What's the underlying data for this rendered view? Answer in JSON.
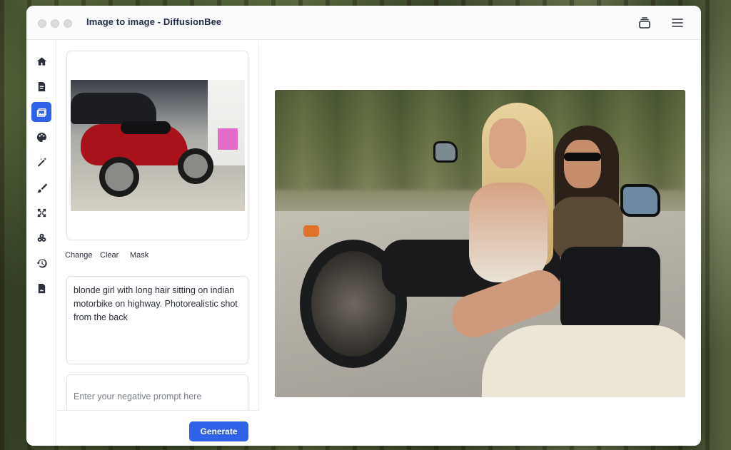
{
  "window": {
    "title": "Image to image - DiffusionBee"
  },
  "titlebar": {
    "icons": [
      "layers-icon",
      "hamburger-menu-icon"
    ]
  },
  "sidebar": {
    "items": [
      {
        "icon": "home-icon",
        "active": false
      },
      {
        "icon": "text-to-image-icon",
        "active": false
      },
      {
        "icon": "image-to-image-icon",
        "active": true
      },
      {
        "icon": "palette-icon",
        "active": false
      },
      {
        "icon": "magic-wand-icon",
        "active": false
      },
      {
        "icon": "brush-icon",
        "active": false
      },
      {
        "icon": "expand-icon",
        "active": false
      },
      {
        "icon": "models-icon",
        "active": false
      },
      {
        "icon": "history-icon",
        "active": false
      },
      {
        "icon": "document-icon",
        "active": false
      }
    ],
    "accent": "#2f62e8"
  },
  "input_image": {
    "actions": {
      "change": "Change",
      "clear": "Clear",
      "mask": "Mask"
    }
  },
  "prompt": {
    "value": "blonde girl with long hair sitting on indian motorbike on highway. Photorealistic shot from the back"
  },
  "negative_prompt": {
    "value": "",
    "placeholder": "Enter your negative prompt here"
  },
  "generate": {
    "label": "Generate"
  }
}
